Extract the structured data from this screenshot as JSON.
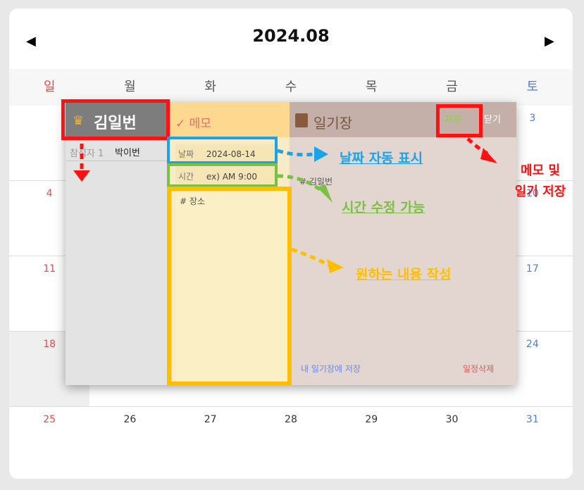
{
  "calendar": {
    "prev_icon": "◀",
    "next_icon": "▶",
    "title": "2024.08",
    "weekdays": [
      "일",
      "월",
      "화",
      "수",
      "목",
      "금",
      "토"
    ],
    "row1": {
      "sat": "3"
    },
    "row2": {
      "sun": "4",
      "sat": "10"
    },
    "row3": {
      "sun": "11",
      "sat": "17"
    },
    "row4": {
      "sun": "18",
      "sat": "24"
    },
    "row5": [
      "25",
      "26",
      "27",
      "28",
      "29",
      "30",
      "31"
    ]
  },
  "popup": {
    "user_name": "김일번",
    "participant_label": "참석자 1",
    "participant_name": "박이번",
    "memo_title": "✓ 메모",
    "date_label": "날짜",
    "date_value": "2024-08-14",
    "time_label": "시간",
    "time_value": "ex) AM 9:00",
    "place_placeholder": "# 장소",
    "diary_title": "일기장",
    "save_label": "저장",
    "close_label": "닫기",
    "diary_tag": "# 김일번",
    "save_to_diary": "내 일기장에 저장",
    "delete_schedule": "일정삭제"
  },
  "annotations": {
    "auto_date": "날짜 자동 표시",
    "time_edit": "시간 수정 가능",
    "write_content": "원하는 내용 작성",
    "save_note": [
      "메모 및",
      "일기 저장"
    ]
  },
  "colors": {
    "sunday": "#e94b4b",
    "saturday": "#4b7de9",
    "annotation_red": "#ff1111",
    "annotation_blue": "#1aa3e8",
    "annotation_green": "#7ac143",
    "annotation_yellow": "#ffbf00"
  }
}
